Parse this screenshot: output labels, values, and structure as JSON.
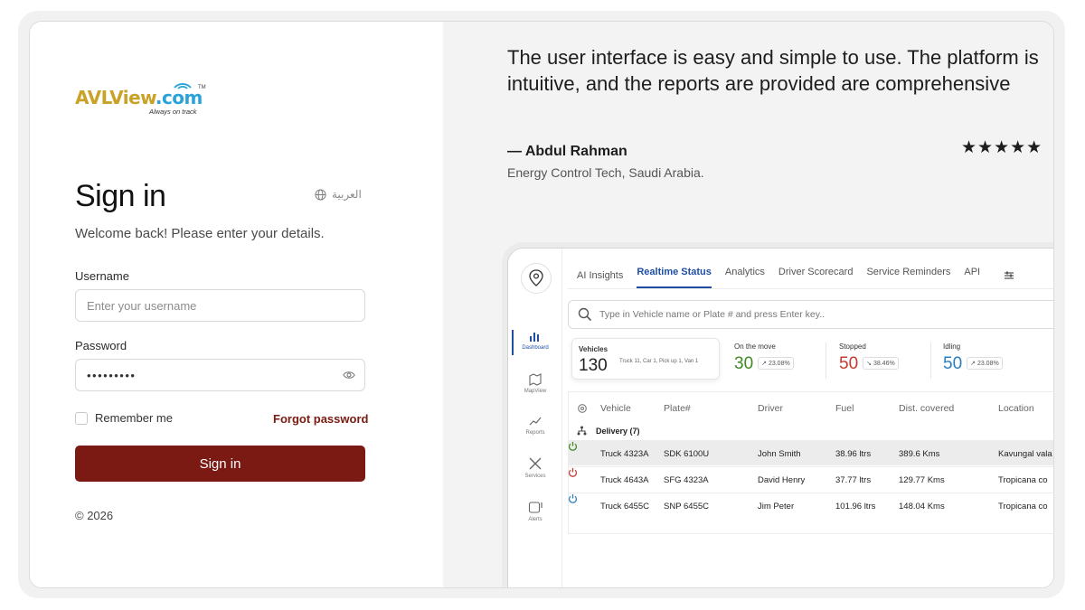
{
  "logo": {
    "text_avl": "AVLView",
    "text_com": ".com",
    "tm": "TM",
    "tagline": "Always on track"
  },
  "signin": {
    "title": "Sign in",
    "language_link": "العربية",
    "welcome": "Welcome back! Please enter your details.",
    "username_label": "Username",
    "username_placeholder": "Enter your username",
    "password_label": "Password",
    "password_value": "•••••••••",
    "remember_label": "Remember me",
    "forgot_label": "Forgot password",
    "submit_label": "Sign in",
    "copyright": "© 2026"
  },
  "testimonial": {
    "quote": "The user interface is easy and simple to use. The platform is intuitive, and the reports are provided are comprehensive",
    "author": "— Abdul Rahman",
    "company": "Energy Control Tech, Saudi Arabia.",
    "stars": "★★★★★",
    "rating": 5
  },
  "dashboard": {
    "tabs": [
      "AI Insights",
      "Realtime Status",
      "Analytics",
      "Driver Scorecard",
      "Service Reminders",
      "API"
    ],
    "active_tab": "Realtime Status",
    "sidebar": [
      "Dashboard",
      "MapView",
      "Reports",
      "Services",
      "Alerts"
    ],
    "search_placeholder": "Type in Vehicle name or Plate # and press Enter key..",
    "vehicles_card": {
      "label": "Vehicles",
      "count": "130",
      "breakdown": "Truck 11, Car 1, Pick up 1, Van 1"
    },
    "stats": [
      {
        "label": "On the move",
        "value": "30",
        "pct": "↗ 23.08%",
        "color": "#3f8a25"
      },
      {
        "label": "Stopped",
        "value": "50",
        "pct": "↘ 38.46%",
        "color": "#c43a2e"
      },
      {
        "label": "Idling",
        "value": "50",
        "pct": "↗ 23.08%",
        "color": "#2a7fc0"
      }
    ],
    "columns": [
      "Vehicle",
      "Plate#",
      "Driver",
      "Fuel",
      "Dist. covered",
      "Location"
    ],
    "group_label": "Delivery (7)",
    "rows": [
      {
        "vehicle": "Truck 4323A",
        "plate": "SDK 6100U",
        "driver": "John Smith",
        "fuel": "38.96 ltrs",
        "dist": "389.6 Kms",
        "location": "Kavungal vala",
        "status_color": "#3f8a25"
      },
      {
        "vehicle": "Truck 4643A",
        "plate": "SFG 4323A",
        "driver": "David Henry",
        "fuel": "37.77 ltrs",
        "dist": "129.77 Kms",
        "location": "Tropicana co",
        "status_color": "#c43a2e"
      },
      {
        "vehicle": "Truck 6455C",
        "plate": "SNP 6455C",
        "driver": "Jim Peter",
        "fuel": "101.96 ltrs",
        "dist": "148.04 Kms",
        "location": "Tropicana co",
        "status_color": "#2a7fc0"
      }
    ]
  }
}
